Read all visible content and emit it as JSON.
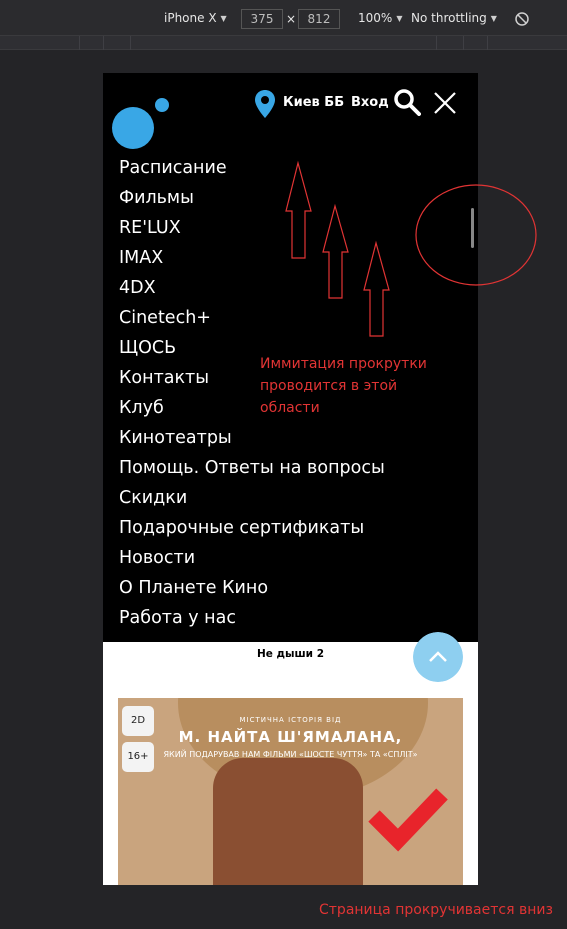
{
  "devtools": {
    "device": "iPhone X",
    "width": "375",
    "times": "×",
    "height": "812",
    "zoom": "100%",
    "throttling": "No throttling",
    "rotate_icon": "rotate-icon"
  },
  "header": {
    "city": "Киев ББ",
    "login": "Вход",
    "icons": [
      "logo-icon",
      "location-pin-icon",
      "search-icon",
      "close-icon"
    ]
  },
  "menu": {
    "items": [
      "Расписание",
      "Фильмы",
      "RE'LUX",
      "IMAX",
      "4DX",
      "Cinetech+",
      "ЩОСЬ",
      "Контакты",
      "Клуб",
      "Кинотеатры",
      "Помощь. Ответы на вопросы",
      "Скидки",
      "Подарочные сертификаты",
      "Новости",
      "О Планете Кино",
      "Работа у нас"
    ]
  },
  "content": {
    "movie_title": "Не дыши 2",
    "poster": {
      "tagline": "МІСТИЧНА ІСТОРІЯ ВІД",
      "name": "М. НАЙТА Ш'ЯМАЛАНА,",
      "subline": "ЯКИЙ ПОДАРУВАВ НАМ ФІЛЬМИ «ШОСТЕ ЧУТТЯ» ТА «СПЛІТ»",
      "format_badge": "2D",
      "age_badge": "16+"
    }
  },
  "annotations": {
    "scroll_note": "Иммитация прокрутки проводится в этой области",
    "bottom_note": "Страница прокручивается вниз"
  },
  "colors": {
    "accent_blue": "#39a7e6",
    "annotation_red": "#e13434",
    "checkmark_red": "#e8242b"
  }
}
